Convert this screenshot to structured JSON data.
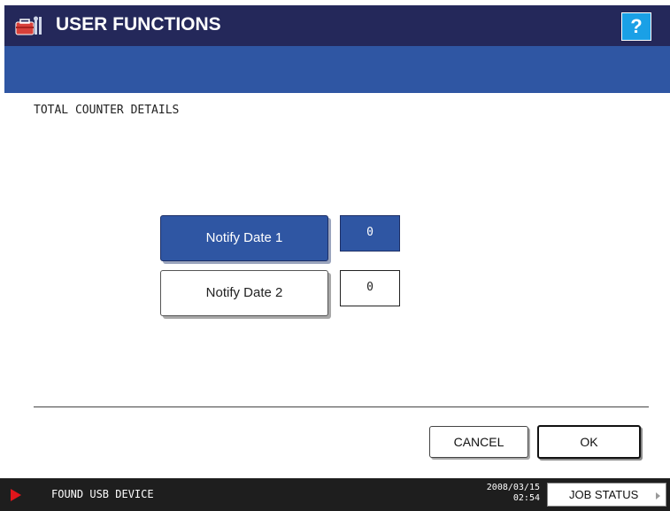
{
  "header": {
    "title": "USER FUNCTIONS",
    "icon": "toolbox-icon",
    "help_label": "?",
    "colors": {
      "title_bar": "#24285a",
      "accent_bar": "#2f56a3",
      "help": "#1aa0e6"
    }
  },
  "main": {
    "section_title": "TOTAL COUNTER DETAILS",
    "rows": [
      {
        "label": "Notify Date 1",
        "value": "0",
        "selected": true
      },
      {
        "label": "Notify Date 2",
        "value": "0",
        "selected": false
      }
    ]
  },
  "actions": {
    "cancel_label": "CANCEL",
    "ok_label": "OK"
  },
  "status": {
    "message": "FOUND USB DEVICE",
    "date": "2008/03/15",
    "time": "02:54",
    "job_status_label": "JOB STATUS",
    "alert_color": "#e0161b"
  }
}
